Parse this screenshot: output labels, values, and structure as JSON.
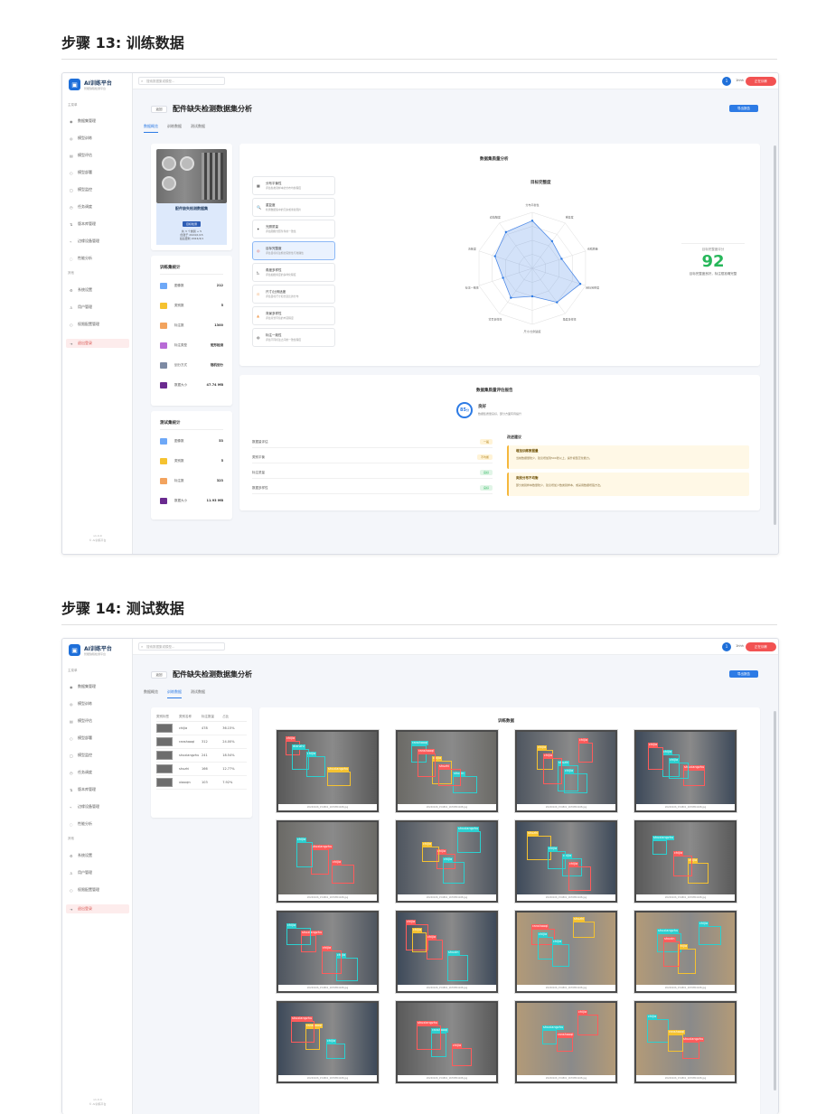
{
  "step13": {
    "title": "步骤 13: 训练数据",
    "app": {
      "logo_title": "AI训练平台",
      "logo_sub": "智能缺陷检测平台",
      "nav_group1": "主菜单",
      "nav": [
        "数据集管理",
        "模型训练",
        "模型评估",
        "模型部署",
        "模型监控",
        "任务调度",
        "版本库管理",
        "边缘设备管理",
        "性能分析"
      ],
      "nav_group2": "其他",
      "nav2": [
        "系统设置",
        "用户管理",
        "权限配置管理",
        "退出登录"
      ],
      "footer": [
        "v1.0.0",
        "© AI训练平台"
      ],
      "search_placeholder": "搜索数据集或模型...",
      "user_initial": "1",
      "user_name": "1hhh",
      "red_button": "正在训练"
    },
    "page": {
      "back": "返回",
      "title": "配件缺失检测数据集分析",
      "export_button": "导出报告",
      "tabs": [
        "数据概览",
        "训练数据",
        "测试数据"
      ]
    },
    "dataset_card": {
      "name": "配件缺失检测数据集",
      "badge": "目标检测",
      "lines": [
        "共 3 个类别 + 5",
        "创建于 2024/1/15",
        "最后更新 2024/4/1"
      ]
    },
    "train_stats": {
      "title": "训练集统计",
      "rows": [
        {
          "label": "图像数",
          "value": "212"
        },
        {
          "label": "类别数",
          "value": "5"
        },
        {
          "label": "标注数",
          "value": "1300"
        },
        {
          "label": "标注类型",
          "value": "矩形检测"
        },
        {
          "label": "划分方式",
          "value": "随机划分"
        },
        {
          "label": "数据大小",
          "value": "47.74 MB"
        }
      ]
    },
    "test_stats": {
      "title": "测试集统计",
      "rows": [
        {
          "label": "图像数",
          "value": "53"
        },
        {
          "label": "类别数",
          "value": "5"
        },
        {
          "label": "标注数",
          "value": "323"
        },
        {
          "label": "数据大小",
          "value": "11.93 MB"
        }
      ]
    },
    "features": {
      "title": "数据集质量分析",
      "items": [
        {
          "title": "分布平衡性",
          "sub": "评估各类别样本的分布均衡程度"
        },
        {
          "title": "重复度",
          "sub": "检测数据集中的冗余或重复图片"
        },
        {
          "title": "光照质量",
          "sub": "评估图像光照条件的一致性"
        },
        {
          "title": "目标完整度",
          "sub": "评估目标标注框的完整性与准确性"
        },
        {
          "title": "角度多样性",
          "sub": "评估拍摄角度的多样化程度"
        },
        {
          "title": "尺寸/比例适度",
          "sub": "评估目标尺寸和长宽比的分布"
        },
        {
          "title": "背景多样性",
          "sub": "评估背景环境的丰富程度"
        },
        {
          "title": "标注一致性",
          "sub": "评估不同标注之间的一致性程度"
        }
      ]
    },
    "radar": {
      "title": "目标完整度",
      "labels": [
        "分布平衡性",
        "重复度",
        "光照质量",
        "目标完整度",
        "角度多样性",
        "尺寸/比例适度",
        "背景多样性",
        "标注一致性",
        "清晰度",
        "遮挡程度"
      ],
      "values": [
        0.85,
        0.6,
        0.55,
        0.9,
        0.75,
        0.5,
        0.65,
        0.55,
        0.7,
        0.8
      ]
    },
    "score": {
      "label": "目标完整度评分",
      "value": "92",
      "desc": "目标完整度良好，标注框准确完整"
    },
    "report": {
      "title": "数据集质量评估报告",
      "score": "85",
      "score_unit": "分",
      "grade": "良好",
      "grade_desc": "数据集质量良好，部分方面有待提升",
      "quality_rows": [
        {
          "label": "数据量评估",
          "tag": "一般"
        },
        {
          "label": "类别平衡",
          "tag": "不均衡"
        },
        {
          "label": "标注质量",
          "tag": "良好"
        },
        {
          "label": "数据多样性",
          "tag": "良好"
        }
      ],
      "suggest_title": "改进建议",
      "suggestions": [
        {
          "title": "增加训练数据量",
          "desc": "当前数据量较少，建议增加到500张以上，提升模型泛化能力。"
        },
        {
          "title": "类别分布不均衡",
          "desc": "部分类别样本数量较少，建议增加少数类别样本，或采用数据增强方法。"
        }
      ]
    }
  },
  "step14": {
    "title": "步骤 14: 测试数据",
    "page": {
      "active_tab": "训练数据"
    },
    "class_table": {
      "headers": [
        "类别标签",
        "类别名称",
        "标注数量",
        "占比"
      ],
      "rows": [
        {
          "name": "chijia",
          "count": "478",
          "ratio": "36.15%"
        },
        {
          "name": "ranshaoqi",
          "count": "312",
          "ratio": "24.00%"
        },
        {
          "name": "shuxiangzhu",
          "count": "241",
          "ratio": "18.54%"
        },
        {
          "name": "shuzhi",
          "count": "166",
          "ratio": "12.77%"
        },
        {
          "name": "xiaoqin",
          "count": "103",
          "ratio": "7.92%"
        }
      ]
    },
    "gallery": {
      "title": "训练数据",
      "caption": "20240106_154801_1676854168.jpg",
      "tiles": [
        {
          "labels": [
            "chijia",
            "chijia",
            "shuxiangzhu",
            "dianzhi"
          ]
        },
        {
          "labels": [
            "ranshaoqi",
            "chijia",
            "shuxin",
            "ranshaoqi",
            "shuzhi"
          ]
        },
        {
          "labels": [
            "chijia",
            "shuzhi",
            "chijia",
            "chijia",
            "chijia"
          ]
        },
        {
          "labels": [
            "chijia",
            "shuxiangzhu",
            "chijia",
            "chijia"
          ]
        },
        {
          "labels": [
            "shuxiangzhu",
            "chijia",
            "chijia"
          ]
        },
        {
          "labels": [
            "chijia",
            "shuxiangzhu",
            "chijia",
            "chijia"
          ]
        },
        {
          "labels": [
            "chijia",
            "shuzhi",
            "chijia",
            "chijia"
          ]
        },
        {
          "labels": [
            "chijia",
            "shuxiangzhu",
            "chijia"
          ]
        },
        {
          "labels": [
            "chijia",
            "shuxiangzhu",
            "chijia",
            "chijia"
          ]
        },
        {
          "labels": [
            "chijia",
            "chijia",
            "shuxin",
            "chijia"
          ]
        },
        {
          "labels": [
            "ranshaoqi",
            "chijia",
            "shuzhi",
            "chijia"
          ]
        },
        {
          "labels": [
            "shuxiangzhu",
            "chijia",
            "chijia",
            "shuxin"
          ]
        },
        {
          "labels": [
            "ranshaoqi",
            "chijia",
            "shuxiangzhu"
          ]
        },
        {
          "labels": [
            "ranshaoqi",
            "chijia",
            "shuxiangzhu"
          ]
        },
        {
          "labels": [
            "ranshaoqi",
            "chijia",
            "shuxiangzhu"
          ]
        },
        {
          "labels": [
            "shuxiangzhu",
            "chijia",
            "ranshaoqi"
          ]
        }
      ]
    }
  },
  "colors": {
    "primary": "#2d7be5",
    "danger": "#f25252",
    "success": "#27b75a",
    "warning": "#f5b83d",
    "bbox_red": "#ff5b5b",
    "bbox_cyan": "#2bd0d0",
    "bbox_yellow": "#f5c230"
  }
}
